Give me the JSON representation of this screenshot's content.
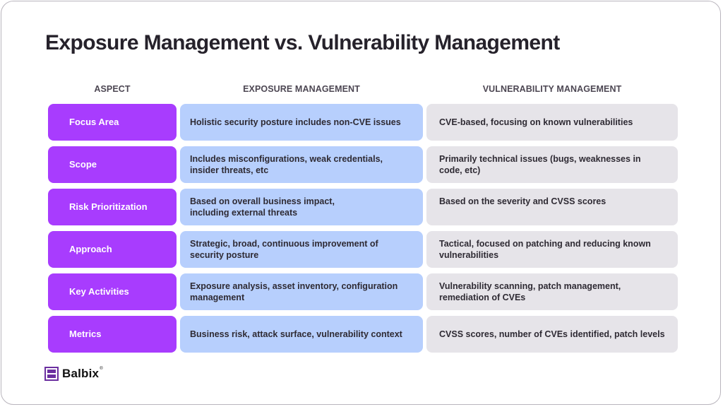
{
  "title": "Exposure Management vs. Vulnerability Management",
  "columns": {
    "aspect": "ASPECT",
    "exposure": "EXPOSURE MANAGEMENT",
    "vulnerability": "VULNERABILITY MANAGEMENT"
  },
  "rows": [
    {
      "aspect": "Focus Area",
      "exposure": "Holistic security posture includes non-CVE issues",
      "vulnerability": "CVE-based, focusing on known vulnerabilities"
    },
    {
      "aspect": "Scope",
      "exposure": "Includes misconfigurations, weak credentials, insider threats, etc",
      "vulnerability": "Primarily technical issues (bugs, weaknesses in code, etc)"
    },
    {
      "aspect": "Risk Prioritization",
      "exposure": "Based on overall business impact, including external threats",
      "vulnerability": "Based on the severity and CVSS scores"
    },
    {
      "aspect": "Approach",
      "exposure": "Strategic, broad, continuous improvement of security posture",
      "vulnerability": "Tactical, focused on patching and reducing known vulnerabilities"
    },
    {
      "aspect": "Key Activities",
      "exposure": "Exposure analysis, asset inventory, configuration management",
      "vulnerability": "Vulnerability scanning, patch management, remediation of CVEs"
    },
    {
      "aspect": "Metrics",
      "exposure": "Business risk, attack surface, vulnerability context",
      "vulnerability": "CVSS scores, number of CVEs identified, patch levels"
    }
  ],
  "brand": {
    "name": "Balbix",
    "registered": "®",
    "icon": "balbix-logo-icon"
  },
  "colors": {
    "aspect_bg": "#a83cfe",
    "exposure_bg": "#b7cffd",
    "vulnerability_bg": "#e6e4e9",
    "title_text": "#26222b",
    "logo_purple": "#6b2fa0"
  }
}
